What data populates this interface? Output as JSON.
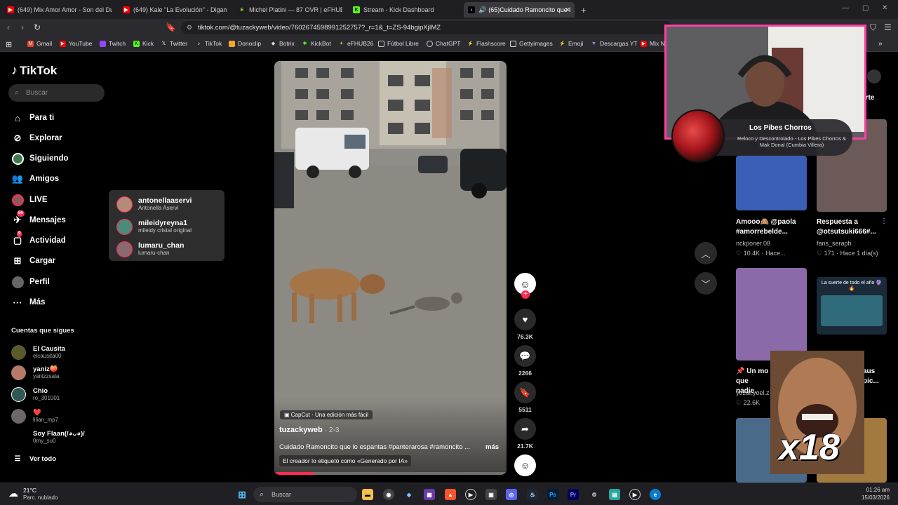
{
  "browser": {
    "tabs": [
      {
        "title": "(649) Mix Amor Amor - Son del Duke",
        "icon": "youtube-icon",
        "color": "#ff0000"
      },
      {
        "title": "(649) Kale \"La Evolución\" - Digame U",
        "icon": "youtube-icon",
        "color": "#ff0000"
      },
      {
        "title": "Michel Platini — 87 OVR | eFHUB",
        "icon": "efhub-icon",
        "color": "#9fdc3a"
      },
      {
        "title": "Stream - Kick Dashboard",
        "icon": "kick-icon",
        "color": "#53fc18"
      },
      {
        "title": "(65)Cuidado Ramoncito que l",
        "icon": "tiktok-icon",
        "color": "#ffffff"
      }
    ],
    "url": "tiktok.com/@tuzackyweb/video/7602674598991252757?_r=1&_t=ZS-94bgipXjIMZ",
    "bookmarks": [
      {
        "label": "Gmail",
        "color": "#ea4335"
      },
      {
        "label": "YouTube",
        "color": "#ff0000"
      },
      {
        "label": "Twitch",
        "color": "#9146ff"
      },
      {
        "label": "Kick",
        "color": "#53fc18"
      },
      {
        "label": "Twitter",
        "color": "#ffffff"
      },
      {
        "label": "TikTok",
        "color": "#ffffff"
      },
      {
        "label": "Donoclip",
        "color": "#f5a623"
      },
      {
        "label": "Botrix",
        "color": "#dddddd"
      },
      {
        "label": "KickBot",
        "color": "#53fc18"
      },
      {
        "label": "eFHUB26",
        "color": "#9fdc3a"
      },
      {
        "label": "Fútbol Libre",
        "color": "#cccccc"
      },
      {
        "label": "ChatGPT",
        "color": "#cccccc"
      },
      {
        "label": "Flashscore",
        "color": "#dddddd"
      },
      {
        "label": "Gettyimages",
        "color": "#dddddd"
      },
      {
        "label": "Emoji",
        "color": "#ff2d55"
      },
      {
        "label": "Descargas YT",
        "color": "#b38cff"
      },
      {
        "label": "Mix N",
        "color": "#ff0000"
      }
    ]
  },
  "tiktok": {
    "logo": "TikTok",
    "search_placeholder": "Buscar",
    "nav": [
      {
        "label": "Para ti",
        "icon": "home-icon"
      },
      {
        "label": "Explorar",
        "icon": "compass-icon"
      },
      {
        "label": "Siguiendo",
        "icon": "following-icon"
      },
      {
        "label": "Amigos",
        "icon": "friends-icon"
      },
      {
        "label": "LIVE",
        "icon": "live-icon"
      },
      {
        "label": "Mensajes",
        "icon": "messages-icon",
        "badge": "56"
      },
      {
        "label": "Actividad",
        "icon": "activity-icon",
        "badge": "9"
      },
      {
        "label": "Cargar",
        "icon": "upload-icon"
      },
      {
        "label": "Perfil",
        "icon": "profile-icon"
      },
      {
        "label": "Más",
        "icon": "more-icon"
      }
    ],
    "following_header": "Cuentas que sigues",
    "following": [
      {
        "name": "El Causita",
        "handle": "elcausita00"
      },
      {
        "name": "yaniz🍑",
        "handle": "yanizzsala"
      },
      {
        "name": "Chio",
        "handle": "ro_301001"
      },
      {
        "name": "❤️",
        "handle": "lilian_mp7"
      },
      {
        "name": "Soy Flaan(/◕ᴗ◕)/",
        "handle": "0my_su0"
      }
    ],
    "see_all": "Ver todo",
    "popup": [
      {
        "name": "antonellaaservi",
        "sub": "Antonella Aservi"
      },
      {
        "name": "mileidyreyna1",
        "sub": "mileidy cristal original"
      },
      {
        "name": "lumaru_chan",
        "sub": "lumaru-chan"
      }
    ],
    "video": {
      "capcut": "CapCut · Una edición más fácil",
      "author": "tuzackyweb",
      "date": "· 2-3",
      "caption": "Cuidado Ramoncito que lo espantas #panterarosa #ramoncito ...",
      "more": "más",
      "ai_label": "El creador lo etiquetó como «Generado por IA»",
      "progress": 0.17
    },
    "actions": {
      "likes": "76.3K",
      "comments": "2266",
      "saves": "5511",
      "shares": "21.7K"
    },
    "right_cards": [
      {
        "title": "Amooo🙈 @paola #amorrebelde...",
        "user": "nckponer.08",
        "stats": "♡ 10.4K · Hace..."
      },
      {
        "title": "Respuesta a @otsutsuki666#...",
        "user": "fans_seraph",
        "stats": "♡ 171 · Hace 1 día(s)"
      },
      {
        "title": "📌 Un mo",
        "title2": "que nadie.",
        "user": "yozar.yoel.z",
        "stats": "♡ 22.6K"
      },
      {
        "title": "aus",
        "title2": "pic...",
        "user": "",
        "stats": ""
      }
    ],
    "comparte": "arte",
    "card_overlay_text": "La suerte de todo el año 🔮🔥"
  },
  "stream_overlay": {
    "song_title": "Los Pibes Chorros",
    "song_subtitle": "Reloco y Descontrolado - Los Pibes Chorros & Mak Donal (Cumbia Villera)",
    "meme_text": "x18"
  },
  "taskbar": {
    "weather_temp": "21°C",
    "weather_desc": "Parc. nublado",
    "search_placeholder": "Buscar",
    "time": "01:26 am",
    "date": "15/03/2026"
  }
}
